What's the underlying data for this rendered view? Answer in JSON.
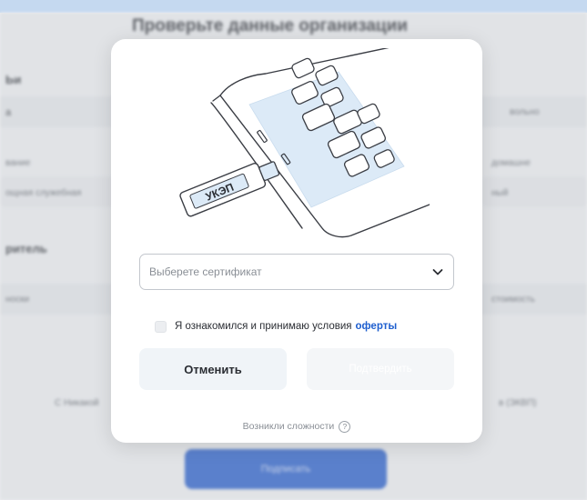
{
  "background": {
    "title": "Проверьте данные организации",
    "section1_label": "Ьи",
    "section2_label": "ритель",
    "row1_left": "а",
    "row1_right": "вольно",
    "row2_left": "вание",
    "row2_sub": "ощная служебная",
    "row2_right": "домашне",
    "row2_right_sub": "ный",
    "row3_left": "носки",
    "row3_right": "стоимость",
    "footer_left": "С Никакой",
    "footer_right": "в (ЭКВП)",
    "primary_button": "Подписать"
  },
  "modal": {
    "illustration": {
      "usb_label": "УКЭП"
    },
    "certificate_select": {
      "placeholder": "Выберете сертификат",
      "icon": "chevron-down-icon"
    },
    "agreement": {
      "text": "Я ознакомился и принимаю условия",
      "link": "оферты",
      "checked": false
    },
    "buttons": {
      "cancel": "Отменить",
      "confirm": "Подтвердить"
    },
    "help": {
      "text": "Возникли сложности",
      "icon": "question-circle-icon",
      "icon_glyph": "?"
    }
  },
  "colors": {
    "accent": "#1f5fcf",
    "primary_button": "#1f58c9",
    "top_strip": "#c5d9f0"
  }
}
